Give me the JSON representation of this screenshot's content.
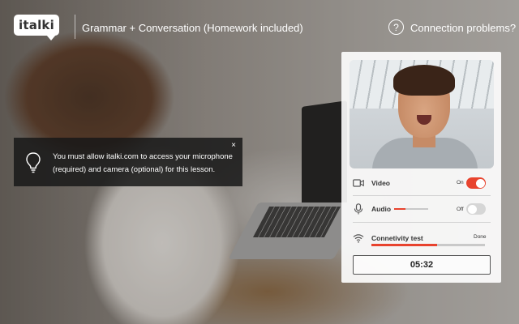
{
  "header": {
    "logo_text": "italki",
    "lesson_title": "Grammar + Conversation (Homework included)",
    "help_icon": "question-circle-icon",
    "help_glyph": "?",
    "connection_problems": "Connection problems?"
  },
  "notification": {
    "icon": "lightbulb-icon",
    "message": "You must allow italki.com to access your microphone (required) and camera (optional) for this lesson.",
    "close_glyph": "×"
  },
  "panel": {
    "video": {
      "icon": "video-camera-icon",
      "label": "Video",
      "state_label": "On",
      "enabled": true
    },
    "audio": {
      "icon": "microphone-icon",
      "label": "Audio",
      "state_label": "Off",
      "enabled": false,
      "level_percent": 33
    },
    "connectivity": {
      "icon": "wifi-icon",
      "label": "Connetivity test",
      "status": "Done",
      "progress_percent": 58
    },
    "timer": "05:32"
  },
  "colors": {
    "accent": "#e8432e",
    "panel_bg": "#ffffff",
    "toast_bg": "#191919"
  }
}
